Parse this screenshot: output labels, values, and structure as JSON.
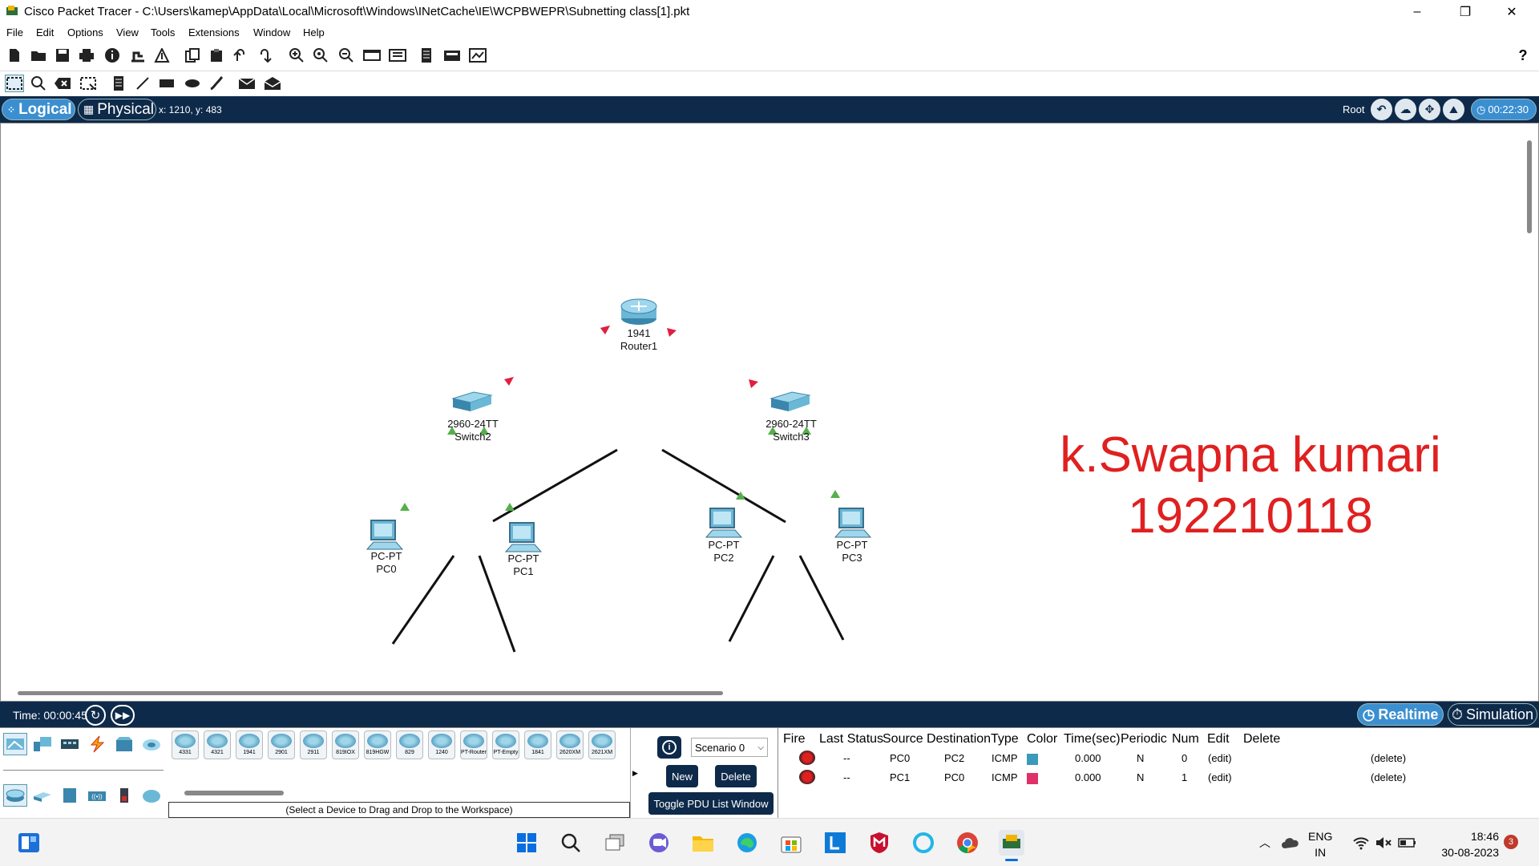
{
  "window": {
    "title": "Cisco Packet Tracer - C:\\Users\\kamep\\AppData\\Local\\Microsoft\\Windows\\INetCache\\IE\\WCPBWEPR\\Subnetting class[1].pkt",
    "minimize": "–",
    "restore": "❐",
    "close": "✕"
  },
  "menu": [
    "File",
    "Edit",
    "Options",
    "View",
    "Tools",
    "Extensions",
    "Window",
    "Help"
  ],
  "toolbar_icons": [
    "new-icon",
    "open-icon",
    "save-icon",
    "print-icon",
    "info-icon",
    "network-wizard-icon",
    "custom-device-icon",
    "copy-icon",
    "paste-icon",
    "undo-icon",
    "redo-icon",
    "zoom-in-icon",
    "zoom-reset-icon",
    "zoom-out-icon",
    "drawing-palette-icon",
    "custom-devices-icon",
    "notes-icon",
    "viewport-icon",
    "cluster-icon"
  ],
  "help": "?",
  "modes": {
    "logical": "Logical",
    "physical": "Physical",
    "coords": "x: 1210, y: 483",
    "root": "Root",
    "clock": "00:22:30"
  },
  "devices": [
    {
      "model": "1941",
      "name": "Router1",
      "type": "router"
    },
    {
      "model": "2960-24TT",
      "name": "Switch2",
      "type": "switch"
    },
    {
      "model": "2960-24TT",
      "name": "Switch3",
      "type": "switch"
    },
    {
      "model": "PC-PT",
      "name": "PC0",
      "type": "pc"
    },
    {
      "model": "PC-PT",
      "name": "PC1",
      "type": "pc"
    },
    {
      "model": "PC-PT",
      "name": "PC2",
      "type": "pc"
    },
    {
      "model": "PC-PT",
      "name": "PC3",
      "type": "pc"
    }
  ],
  "annotation": {
    "line1": "k.Swapna kumari",
    "line2": "192210118"
  },
  "status": {
    "time": "Time: 00:00:45",
    "realtime": "Realtime",
    "simulation": "Simulation"
  },
  "device_models": [
    "4331",
    "4321",
    "1941",
    "2901",
    "2911",
    "819IOX",
    "819HGW",
    "829",
    "1240",
    "PT-Router",
    "PT-Empty",
    "1841",
    "2620XM",
    "2621XM"
  ],
  "device_hint": "(Select a Device to Drag and Drop to the Workspace)",
  "scenario": {
    "select": "Scenario 0",
    "new": "New",
    "delete": "Delete",
    "toggle": "Toggle PDU List Window"
  },
  "pdu_headers": [
    "Fire",
    "Last Status",
    "Source",
    "Destination",
    "Type",
    "Color",
    "Time(sec)",
    "Periodic",
    "Num",
    "Edit",
    "Delete"
  ],
  "pdu_rows": [
    {
      "last": "--",
      "source": "PC0",
      "dest": "PC2",
      "type": "ICMP",
      "color": "#3a9ab8",
      "time": "0.000",
      "periodic": "N",
      "num": "0",
      "edit": "(edit)",
      "delete": "(delete)"
    },
    {
      "last": "--",
      "source": "PC1",
      "dest": "PC0",
      "type": "ICMP",
      "color": "#e0306a",
      "time": "0.000",
      "periodic": "N",
      "num": "1",
      "edit": "(edit)",
      "delete": "(delete)"
    }
  ],
  "taskbar": {
    "lang1": "ENG",
    "lang2": "IN",
    "time": "18:46",
    "date": "30-08-2023",
    "badge": "3"
  }
}
